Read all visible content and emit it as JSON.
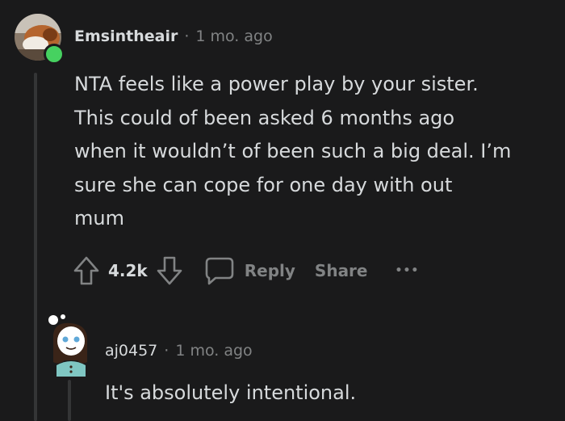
{
  "comment": {
    "username": "Emsintheair",
    "separator": "·",
    "time": "1 mo. ago",
    "lines": [
      "NTA feels like a power play by your sister.",
      "This could of been asked 6 months ago",
      "when it wouldn’t of been such a big deal. I’m",
      "sure she can cope for one day with out",
      "mum"
    ],
    "score": "4.2k",
    "reply_label": "Reply",
    "share_label": "Share",
    "more_label": "•••",
    "avatar_status_color": "#46d160"
  },
  "reply": {
    "username": "aj0457",
    "separator": "·",
    "time": "1 mo. ago",
    "text": "It's absolutely intentional."
  },
  "icons": {
    "upvote": "upvote-arrow-icon",
    "downvote": "downvote-arrow-icon",
    "reply": "speech-bubble-icon"
  },
  "colors": {
    "background": "#1a1a1b",
    "text": "#d7dadc",
    "muted": "#818384",
    "thread_line": "#343536"
  }
}
